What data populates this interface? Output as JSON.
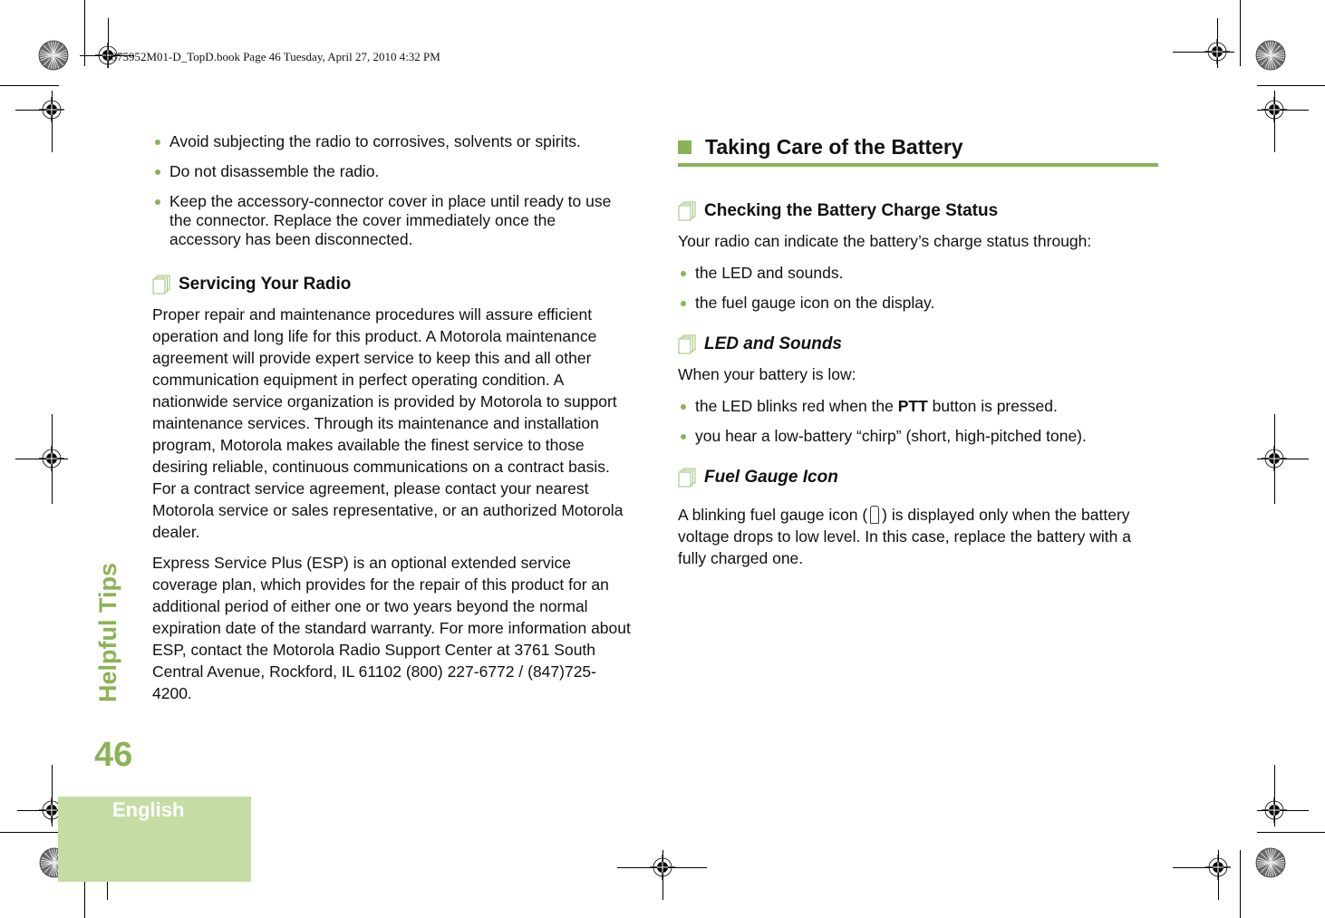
{
  "slug": "6875952M01-D_TopD.book  Page 46  Tuesday, April 27, 2010  4:32 PM",
  "side_title": "Helpful Tips",
  "page_number": "46",
  "language_tab": "English",
  "accent_color": "#8bb356",
  "left_column": {
    "bullets": [
      "Avoid subjecting the radio to corrosives, solvents or spirits.",
      "Do not disassemble the radio.",
      "Keep the accessory-connector cover in place until ready to use the connector. Replace the cover immediately once the accessory has been disconnected."
    ],
    "servicing": {
      "heading": "Servicing Your Radio",
      "paragraph1": "Proper repair and maintenance procedures will assure efficient operation and long life for this product. A Motorola maintenance agreement will provide expert service to keep this and all other communication equipment in perfect operating condition. A nationwide service organization is provided by Motorola to support maintenance services. Through its maintenance and installation program, Motorola makes available the finest service to those desiring reliable, continuous communications on a contract basis. For a contract service agreement, please contact your nearest Motorola service or sales representative, or an authorized Motorola dealer.",
      "paragraph2": "Express Service Plus (ESP) is an optional extended service coverage plan, which provides for the repair of this product for an additional period of either one or two years beyond the normal expiration date of the standard warranty. For more information about ESP, contact the Motorola Radio Support Center at 3761 South Central Avenue, Rockford, IL 61102 (800) 227-6772 / (847)725-4200."
    }
  },
  "right_column": {
    "section_title": "Taking Care of the Battery",
    "charge_status": {
      "heading": "Checking the Battery Charge Status",
      "intro": "Your radio can indicate the battery’s charge status through:",
      "bullets": [
        "the LED and sounds.",
        "the fuel gauge icon on the display."
      ]
    },
    "led_sounds": {
      "heading": "LED and Sounds",
      "intro": "When your battery is low:",
      "bullet1_pre": "the LED blinks red when the ",
      "bullet1_bold": "PTT",
      "bullet1_post": " button is pressed.",
      "bullet2": "you hear a low-battery “chirp” (short, high-pitched tone)."
    },
    "fuel_gauge": {
      "heading": "Fuel Gauge Icon",
      "text_pre": "A blinking fuel gauge icon (",
      "icon": "battery-empty-icon",
      "text_post": ") is displayed only when the battery voltage drops to low level. In this case, replace the battery with a fully charged one."
    }
  }
}
